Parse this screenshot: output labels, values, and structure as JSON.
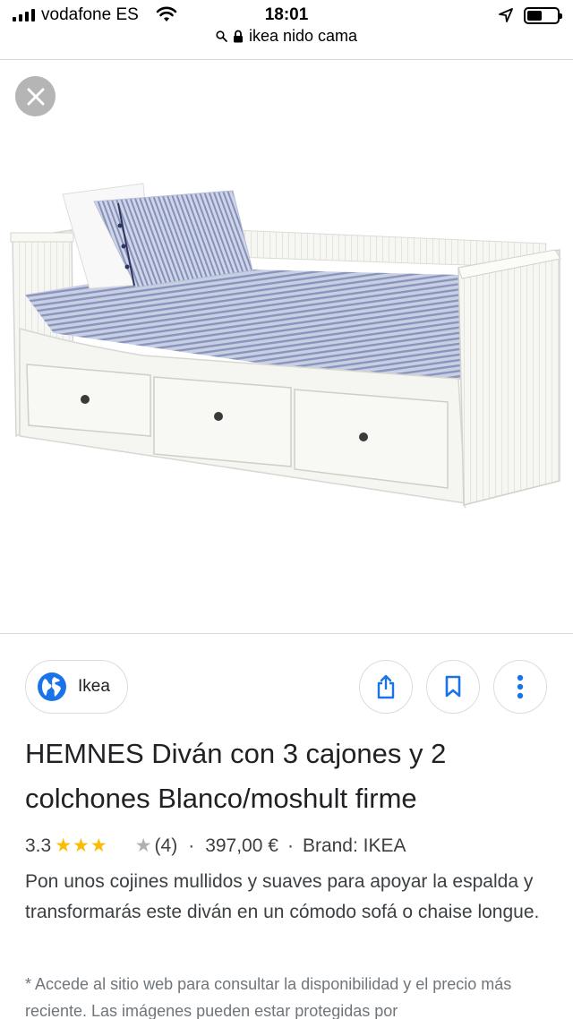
{
  "status_bar": {
    "carrier": "vodafone ES",
    "time": "18:01"
  },
  "url_bar": {
    "query": "ikea nido cama"
  },
  "image_viewer": {
    "close_icon": "close-icon",
    "image_subject": "white daybed with 3 drawers and striped bedding"
  },
  "source": {
    "name": "Ikea",
    "icon": "globe-icon"
  },
  "actions": {
    "share_icon": "share-icon",
    "save_icon": "bookmark-icon",
    "more_icon": "more-vert-icon"
  },
  "product": {
    "title": "HEMNES Diván con 3 cajones y 2 colchones Blanco/moshult firme",
    "rating": "3.3",
    "rating_value": 3.3,
    "rating_max": 5,
    "review_count": "(4)",
    "separator": "·",
    "price": "397,00 €",
    "brand": "Brand: IKEA",
    "description": "Pon unos cojines mullidos y suaves para apoyar la espalda y transformarás este diván en un cómodo sofá o chaise longue.",
    "note": "* Accede al sitio web para consultar la disponibilidad y el precio más reciente. Las imágenes pueden estar protegidas por"
  },
  "colors": {
    "star": "#fbbc04",
    "accent": "#1a73e8",
    "text": "#202124"
  }
}
